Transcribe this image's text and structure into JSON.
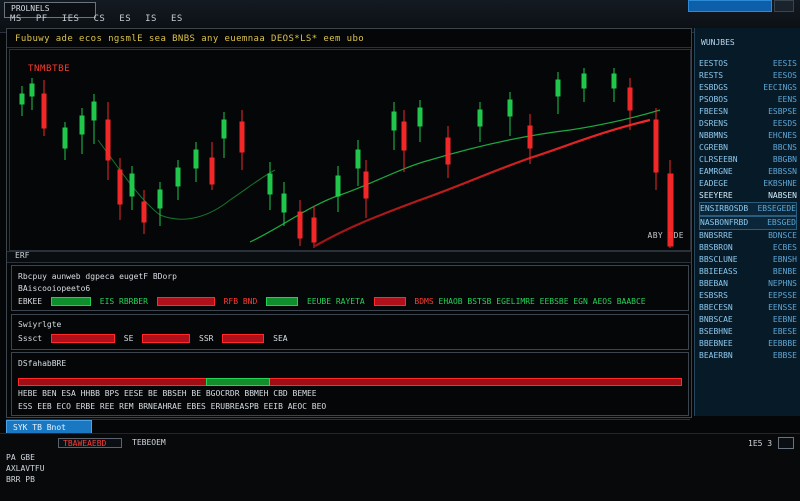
{
  "window": {
    "title": "PROLNELS",
    "menu": [
      "MS",
      "PF",
      "IES",
      "CS",
      "ES",
      "IS",
      "ES"
    ]
  },
  "chart": {
    "header_ticker": "Fubuwy  ade  ecos  ngsmlE  sea  BNBS  any  euemnaa  DEOS*LS*  eem  ubo",
    "top_left_label": "TNMBTBE",
    "bottom_right_label": "ABY BDE"
  },
  "chart_data": {
    "type": "candlestick",
    "series": [],
    "x": [],
    "y": [],
    "xlim": [
      0,
      1
    ],
    "ylim": [
      0,
      1
    ],
    "title": "",
    "xlabel": "",
    "ylabel": "",
    "grid": false,
    "legend": "none"
  },
  "strip": {
    "label": "ERF"
  },
  "panels": {
    "p1": {
      "row1": "Rbcpuy  aunweb  dgpeca  eugetF  BDorp",
      "row2": "BAiscooiopeeto6",
      "row3": {
        "left": "EBKEE",
        "mid_green": "EIS   RBRBER",
        "mid_red": "RFB  BND",
        "right_green": "EEUBE  RAYETA",
        "right_red": "BDMS",
        "far_right": "EHAOB  BSTSB  EGELIMRE  EEBSBE  EGN  AEOS  BAABCE"
      }
    },
    "p2": {
      "row1": "Swiyrlgte",
      "row2": {
        "a": "Sssct",
        "b": "SE",
        "c": "SSR",
        "d": "SEA"
      }
    },
    "p3": {
      "row1": "DSfahabBRE",
      "row2": "HEBE  BEN  ESA  HHBB  BPS  EESE  BE  BBSEH  BE  BGOCRDR  BBMEH  CBD  BEMEE",
      "row3": "ESS  EEB  ECO  ERBE  REE  REM  BRNEAHRAE  EBES  ERUBREASPB  EEIB  AEOC  BEO"
    }
  },
  "bottom_tabs": {
    "active": "SYK  TB  Bnot"
  },
  "lower": {
    "tab1": "TBAWEAEBD",
    "tab2": "TEBEOEM",
    "right": "1E5  3",
    "list": [
      "PA  GBE",
      "AXLAVTFU",
      "BRR  PB"
    ]
  },
  "sidebar": {
    "title": "WUNJBES",
    "rows": [
      {
        "k": "EESTOS",
        "v": "EESIS"
      },
      {
        "k": "RESTS",
        "v": "EESOS"
      },
      {
        "k": "ESBDGS",
        "v": "EECINGS"
      },
      {
        "k": "PSOBOS",
        "v": "EENS"
      },
      {
        "k": "FBEESN",
        "v": "ESBPSE"
      },
      {
        "k": "DSRENS",
        "v": "EESDS"
      },
      {
        "k": "NBBMNS",
        "v": "EHCNES"
      },
      {
        "k": "CGREBN",
        "v": "BBCNS"
      },
      {
        "k": "CLRSEEBN",
        "v": "BBGBN"
      },
      {
        "k": "EAMRGNE",
        "v": "EBBSSN"
      },
      {
        "k": "EADEGE",
        "v": "EKBSHNE"
      },
      {
        "k": "SEEYERE",
        "v": "NABSEN"
      },
      {
        "k": "ENSIRBOSDB",
        "v": "EBSEGEDE"
      },
      {
        "k": "NASBONFRBD",
        "v": "EBSGED"
      },
      {
        "k": "BNBSRRE",
        "v": "BDNSCE"
      },
      {
        "k": "BBSBRON",
        "v": "ECBES"
      },
      {
        "k": "BBSCLUNE",
        "v": "EBNSH"
      },
      {
        "k": "BBIEEASS",
        "v": "BENBE"
      },
      {
        "k": "BBEBAN",
        "v": "NEPHNS"
      },
      {
        "k": "ESBSRS",
        "v": "EEPSSE"
      },
      {
        "k": "BBECESN",
        "v": "EENSSE"
      },
      {
        "k": "BNBSCAE",
        "v": "EEBNE"
      },
      {
        "k": "BSEBHNE",
        "v": "EBESE"
      },
      {
        "k": "BBEBNEE",
        "v": "EEBBBE"
      },
      {
        "k": "BEAERBN",
        "v": "EBBSE"
      }
    ]
  }
}
